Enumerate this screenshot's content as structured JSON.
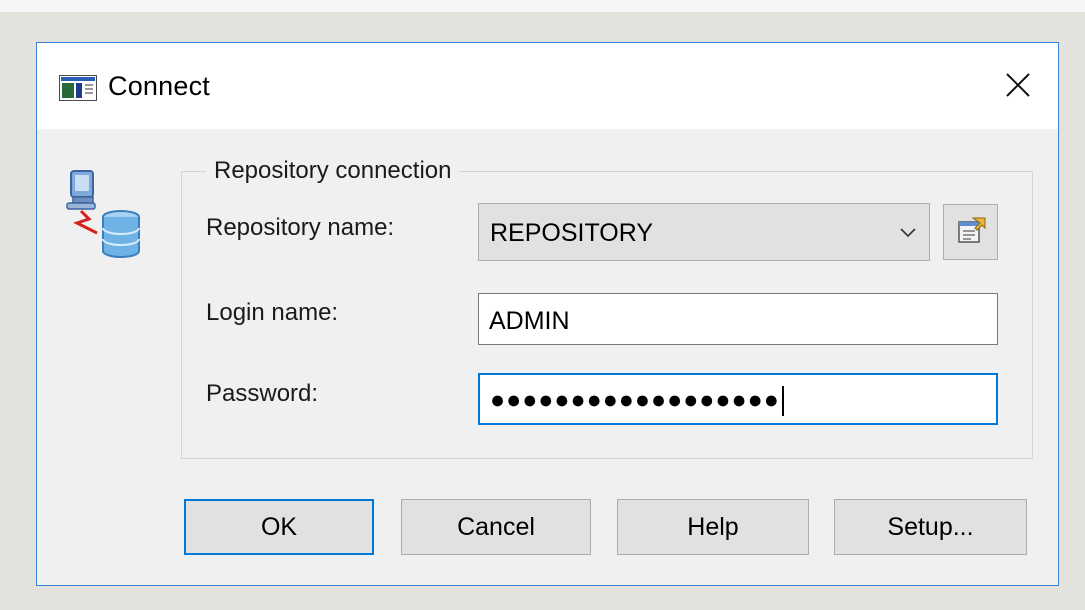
{
  "window": {
    "title": "Connect",
    "accent_color": "#0078d7",
    "border_color": "#3a86d6",
    "icons": {
      "app": "window-app-icon",
      "close": "close-icon",
      "side": "database-connection-icon",
      "combo_arrow": "chevron-down-icon",
      "properties": "properties-icon"
    }
  },
  "group": {
    "legend": "Repository connection"
  },
  "fields": {
    "repository": {
      "label": "Repository name:",
      "value": "REPOSITORY"
    },
    "login": {
      "label": "Login name:",
      "value": "ADMIN"
    },
    "password": {
      "label": "Password:",
      "value": "●●●●●●●●●●●●●●●●●●"
    }
  },
  "buttons": {
    "ok": "OK",
    "cancel": "Cancel",
    "help": "Help",
    "setup": "Setup..."
  }
}
